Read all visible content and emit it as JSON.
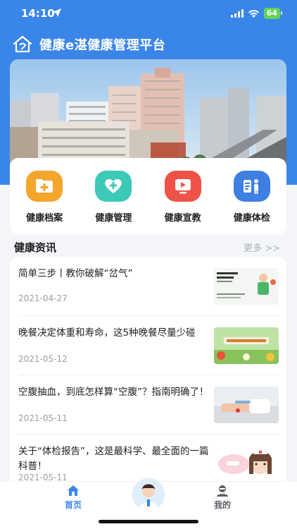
{
  "status_bar": {
    "time": "14:10",
    "battery": "64"
  },
  "header": {
    "title": "健康e湛健康管理平台"
  },
  "menu": [
    {
      "label": "健康档案",
      "icon": "folder-plus-icon",
      "color": "#f3a52c"
    },
    {
      "label": "健康管理",
      "icon": "heart-plus-icon",
      "color": "#3cc9b6"
    },
    {
      "label": "健康宣教",
      "icon": "video-icon",
      "color": "#ef5246"
    },
    {
      "label": "健康体检",
      "icon": "checkup-icon",
      "color": "#3d7fe3"
    }
  ],
  "news_section": {
    "title": "健康资讯",
    "more": "更多 >>"
  },
  "news": [
    {
      "title": "简单三步丨教你破解“岔气”",
      "date": "2021-04-27"
    },
    {
      "title": "晚餐决定体重和寿命，这5种晚餐尽量少碰",
      "date": "2021-05-12"
    },
    {
      "title": "空腹抽血，到底怎样算“空腹”？指南明确了！",
      "date": "2021-05-11"
    },
    {
      "title": "关于“体检报告”，这是最科学、最全面的一篇科普！",
      "date": "2021-05-11"
    }
  ],
  "tabs": {
    "home": "首页",
    "mine": "我的"
  },
  "colors": {
    "primary": "#3a86e8"
  }
}
